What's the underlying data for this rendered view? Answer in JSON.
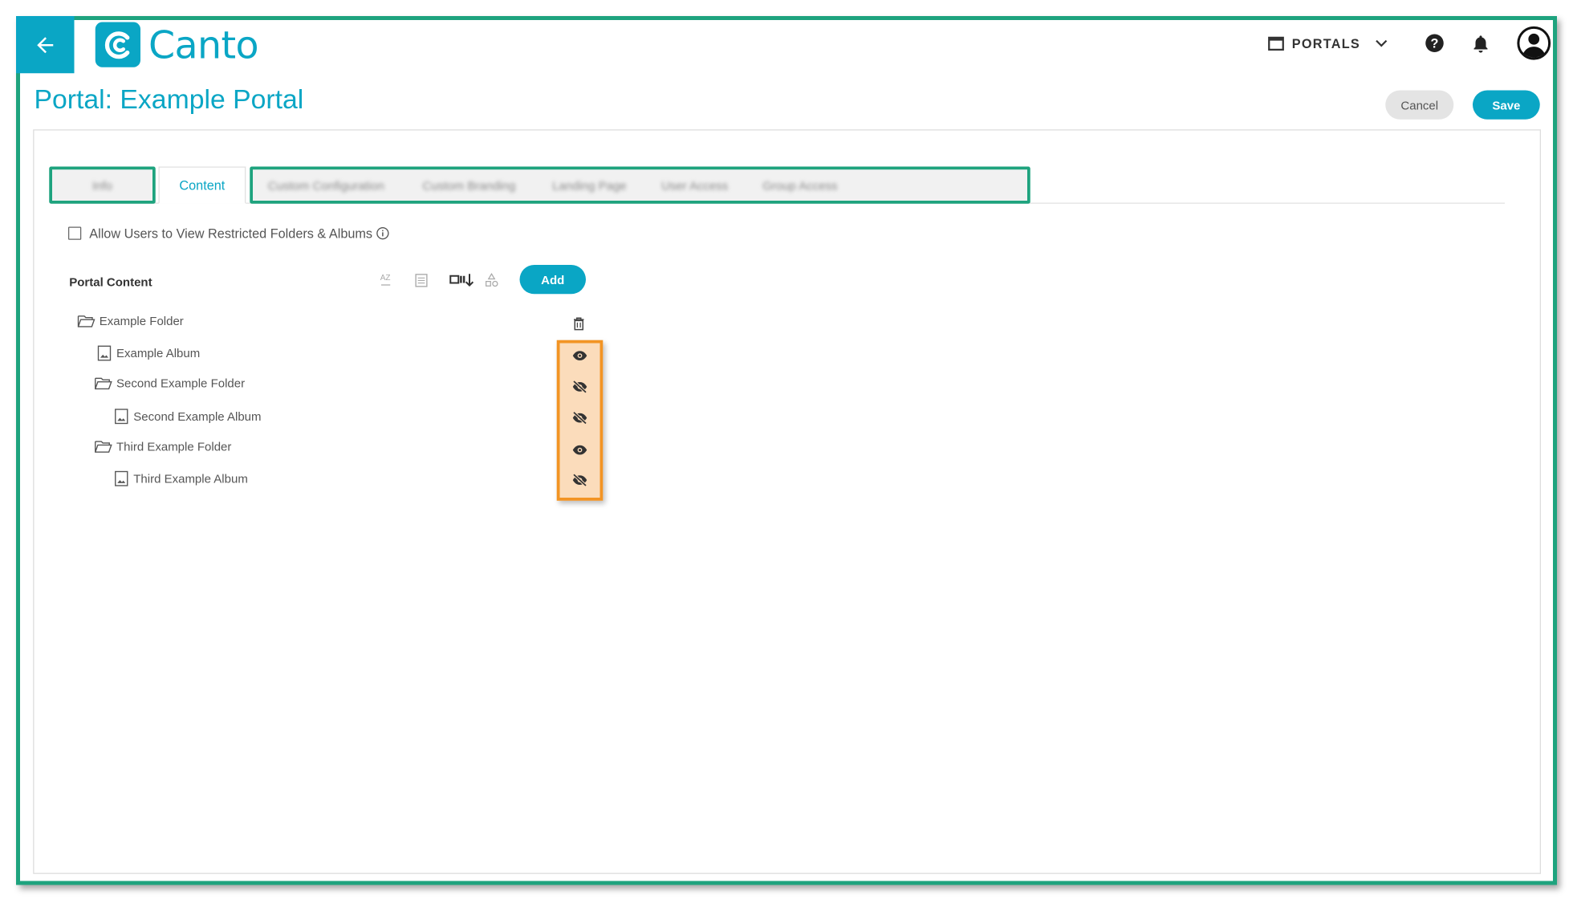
{
  "app": {
    "logo_text": "Canto",
    "brand_color": "#0aa6c5",
    "highlight_green": "#1ea37e",
    "highlight_orange": "#f29424"
  },
  "header": {
    "portals_label": "PORTALS"
  },
  "page": {
    "title": "Portal: Example Portal",
    "cancel_label": "Cancel",
    "save_label": "Save"
  },
  "tabs": [
    {
      "label": "Info",
      "blurred": true
    },
    {
      "label": "Content",
      "active": true
    },
    {
      "label": "Custom Configuration",
      "blurred": true
    },
    {
      "label": "Custom Branding",
      "blurred": true
    },
    {
      "label": "Landing Page",
      "blurred": true
    },
    {
      "label": "User Access",
      "blurred": true
    },
    {
      "label": "Group Access",
      "blurred": true
    }
  ],
  "restricted": {
    "label": "Allow Users to View Restricted Folders & Albums",
    "checked": false
  },
  "portal_content": {
    "heading": "Portal Content",
    "add_label": "Add",
    "sort_az_label": "AZ",
    "tree": [
      {
        "label": "Example Folder",
        "type": "folder",
        "level": 0
      },
      {
        "label": "Example Album",
        "type": "album",
        "level": 1,
        "visible": true
      },
      {
        "label": "Second Example Folder",
        "type": "folder",
        "level": 1,
        "visible": false
      },
      {
        "label": "Second Example Album",
        "type": "album",
        "level": 2,
        "visible": false
      },
      {
        "label": "Third Example Folder",
        "type": "folder",
        "level": 1,
        "visible": true
      },
      {
        "label": "Third Example Album",
        "type": "album",
        "level": 2,
        "visible": false
      }
    ]
  }
}
